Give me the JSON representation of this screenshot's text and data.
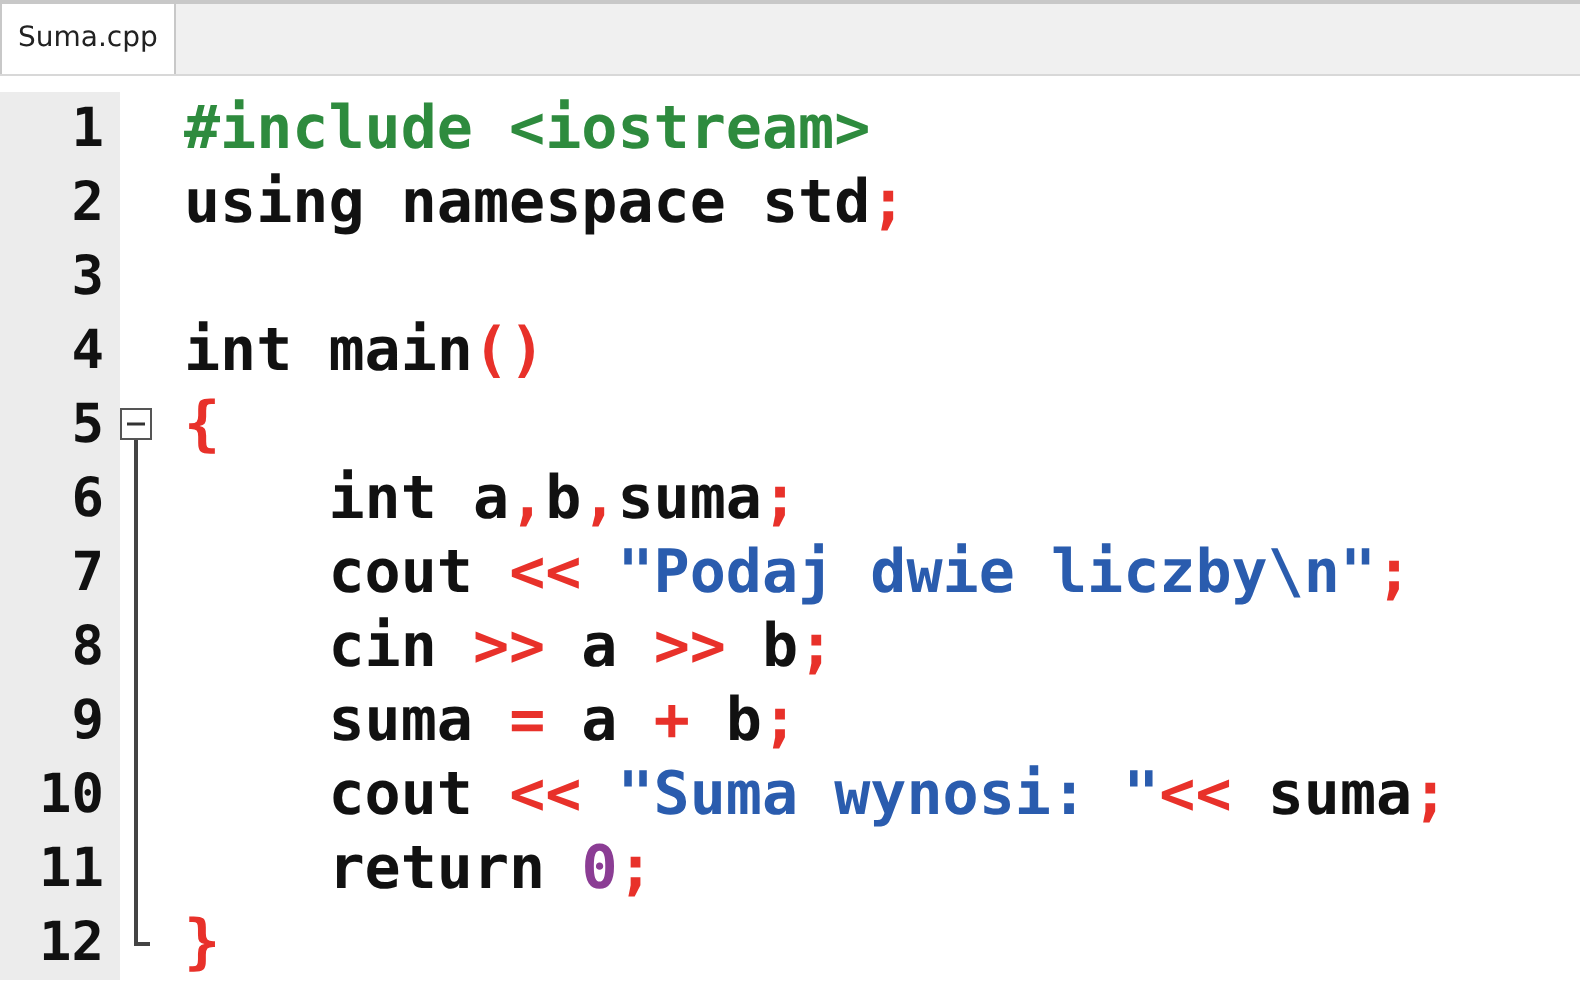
{
  "tabs": [
    {
      "label": "Suma.cpp",
      "selected": true
    }
  ],
  "lines": [
    {
      "number": "1",
      "kind": "line",
      "tokens": [
        {
          "kind": "preprocessor",
          "text": "#include <iostream>"
        }
      ]
    },
    {
      "number": "2",
      "kind": "line",
      "tokens": [
        {
          "kind": "plain",
          "text": "using namespace std"
        },
        {
          "kind": "operator",
          "text": ";"
        }
      ]
    },
    {
      "number": "3",
      "kind": "line"
    },
    {
      "number": "4",
      "kind": "line",
      "tokens": [
        {
          "kind": "plain",
          "text": "int main"
        },
        {
          "kind": "operator",
          "text": "()"
        }
      ]
    },
    {
      "number": "5",
      "kind": "fold_start",
      "expanded": true,
      "tokens": [
        {
          "kind": "operator",
          "text": "{"
        }
      ]
    },
    {
      "number": "6",
      "kind": "fold_body",
      "tokens": [
        {
          "kind": "plain",
          "text": "    int a"
        },
        {
          "kind": "operator",
          "text": ","
        },
        {
          "kind": "plain",
          "text": "b"
        },
        {
          "kind": "operator",
          "text": ","
        },
        {
          "kind": "plain",
          "text": "suma"
        },
        {
          "kind": "operator",
          "text": ";"
        }
      ]
    },
    {
      "number": "7",
      "kind": "fold_body",
      "tokens": [
        {
          "kind": "plain",
          "text": "    cout "
        },
        {
          "kind": "operator",
          "text": "<<"
        },
        {
          "kind": "string",
          "text": " \"Podaj dwie liczby\\n\""
        },
        {
          "kind": "operator",
          "text": ";"
        }
      ]
    },
    {
      "number": "8",
      "kind": "fold_body",
      "tokens": [
        {
          "kind": "plain",
          "text": "    cin "
        },
        {
          "kind": "operator",
          "text": ">>"
        },
        {
          "kind": "plain",
          "text": " a "
        },
        {
          "kind": "operator",
          "text": ">>"
        },
        {
          "kind": "plain",
          "text": " b"
        },
        {
          "kind": "operator",
          "text": ";"
        }
      ]
    },
    {
      "number": "9",
      "kind": "fold_body",
      "tokens": [
        {
          "kind": "plain",
          "text": "    suma "
        },
        {
          "kind": "operator",
          "text": "="
        },
        {
          "kind": "plain",
          "text": " a "
        },
        {
          "kind": "operator",
          "text": "+"
        },
        {
          "kind": "plain",
          "text": " b"
        },
        {
          "kind": "operator",
          "text": ";"
        }
      ]
    },
    {
      "number": "10",
      "kind": "fold_body",
      "tokens": [
        {
          "kind": "plain",
          "text": "    cout "
        },
        {
          "kind": "operator",
          "text": "<<"
        },
        {
          "kind": "string",
          "text": " \"Suma wynosi: \""
        },
        {
          "kind": "operator",
          "text": "<<"
        },
        {
          "kind": "plain",
          "text": " suma"
        },
        {
          "kind": "operator",
          "text": ";"
        }
      ]
    },
    {
      "number": "11",
      "kind": "fold_body",
      "tokens": [
        {
          "kind": "plain",
          "text": "    return "
        },
        {
          "kind": "number",
          "text": "0"
        },
        {
          "kind": "operator",
          "text": ";"
        }
      ]
    },
    {
      "number": "12",
      "kind": "fold_end",
      "tokens": [
        {
          "kind": "operator",
          "text": "}"
        }
      ]
    }
  ]
}
